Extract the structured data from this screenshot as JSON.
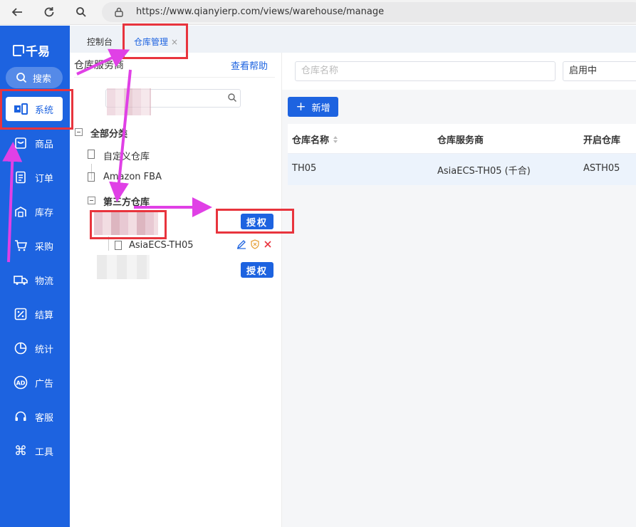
{
  "browser": {
    "url": "https://www.qianyierp.com/views/warehouse/manage"
  },
  "sidebar": {
    "logo": "千易",
    "search_label": "搜索",
    "items": [
      {
        "label": "系统",
        "icon": "system-icon"
      },
      {
        "label": "商品",
        "icon": "product-icon"
      },
      {
        "label": "订单",
        "icon": "order-icon"
      },
      {
        "label": "库存",
        "icon": "inventory-icon"
      },
      {
        "label": "采购",
        "icon": "purchase-icon"
      },
      {
        "label": "物流",
        "icon": "truck-icon"
      },
      {
        "label": "结算",
        "icon": "percent-icon"
      },
      {
        "label": "统计",
        "icon": "pie-chart-icon"
      },
      {
        "label": "广告",
        "icon": "ad-icon"
      },
      {
        "label": "客服",
        "icon": "headset-icon"
      },
      {
        "label": "工具",
        "icon": "command-icon"
      }
    ]
  },
  "tabs": [
    {
      "label": "控制台"
    },
    {
      "label": "仓库管理",
      "close": "×"
    }
  ],
  "left_panel": {
    "title": "仓库服务商",
    "help": "查看帮助",
    "tree": {
      "root": "全部分类",
      "items": [
        "自定义仓库",
        "Amazon FBA",
        "第三方仓库"
      ],
      "child": "AsiaECS-TH05",
      "auth_label": "授权"
    }
  },
  "right_panel": {
    "filter": {
      "name_placeholder": "仓库名称",
      "status_value": "启用中"
    },
    "new_button": "新增",
    "table": {
      "columns": [
        "仓库名称",
        "仓库服务商",
        "开启仓库"
      ],
      "rows": [
        [
          "TH05",
          "AsiaECS-TH05 (千合)",
          "ASTH05"
        ]
      ]
    }
  },
  "colors": {
    "accent": "#1d63e0",
    "annotation_box": "#e8343d",
    "annotation_arrow": "#e040e6"
  }
}
